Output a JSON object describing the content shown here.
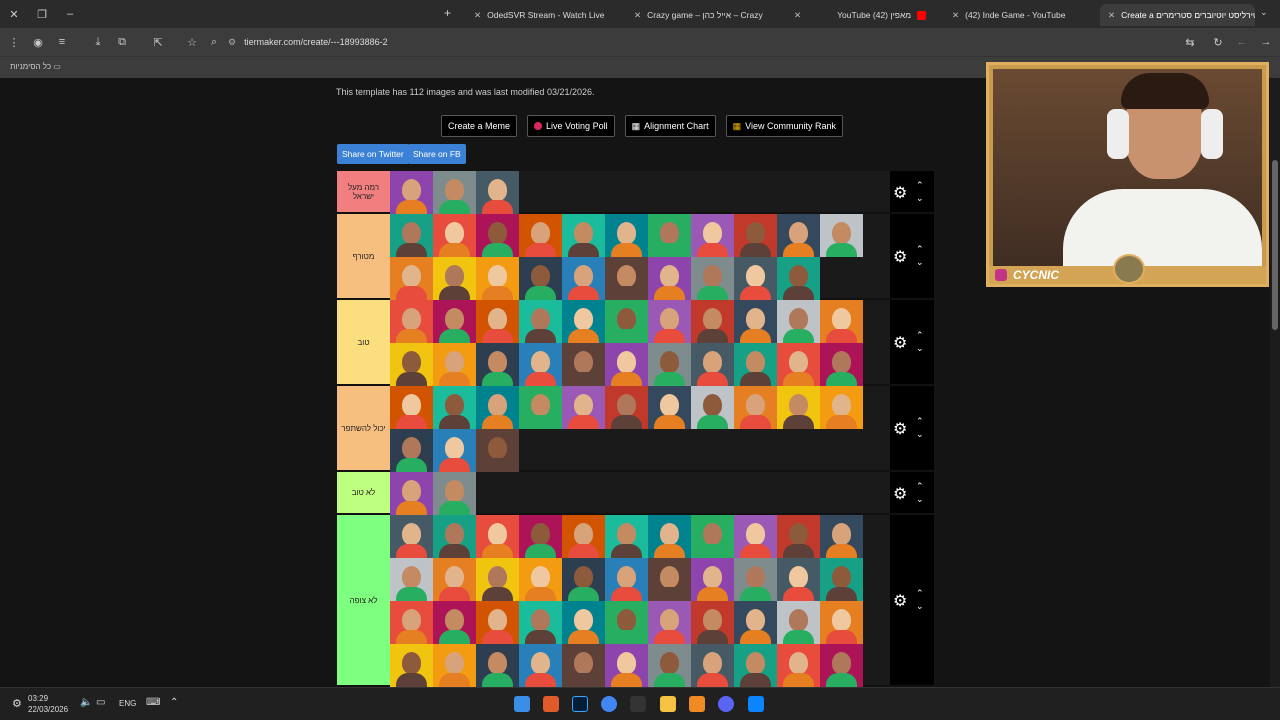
{
  "tabs": [
    {
      "label": "OdedSVR Stream - Watch Live",
      "active": false
    },
    {
      "label": "Crazy game – אייל כהן – Crazy",
      "active": false
    },
    {
      "label": "YouTube (42) מאפין",
      "active": false
    },
    {
      "label": "(42) Inde Game - YouTube",
      "active": false
    },
    {
      "label": "Create a טירליסט יוטיוברים סטרימרים",
      "active": true
    }
  ],
  "address": {
    "url": "tiermaker.com/create/---18993886-2"
  },
  "bookmarks": {
    "label": "כל הסימניות"
  },
  "template_info": "This template has 112 images and was last modified 03/21/2026.",
  "buttons": {
    "create_meme": "Create a Meme",
    "live_poll": "Live Voting Poll",
    "alignment": "Alignment Chart",
    "community": "View Community Rank"
  },
  "share": {
    "twitter": "Share on Twitter",
    "fb": "Share on FB"
  },
  "tiers": [
    {
      "label": "רמה מעל ישראל",
      "color": "#f27f7f",
      "count": 3
    },
    {
      "label": "מטורף",
      "color": "#f7bf7f",
      "count": 21
    },
    {
      "label": "טוב",
      "color": "#fbdf7f",
      "count": 22
    },
    {
      "label": "יכול להשתפר",
      "color": "#f7bf7f",
      "count": 14
    },
    {
      "label": "לא טוב",
      "color": "#bfff7f",
      "count": 2
    },
    {
      "label": "לא צופה",
      "color": "#7fff7f",
      "count": 44
    }
  ],
  "webcam": {
    "name": "CYCNIC"
  },
  "taskbar": {
    "time": "03:29",
    "date": "22/03/2026",
    "lang": "ENG"
  }
}
